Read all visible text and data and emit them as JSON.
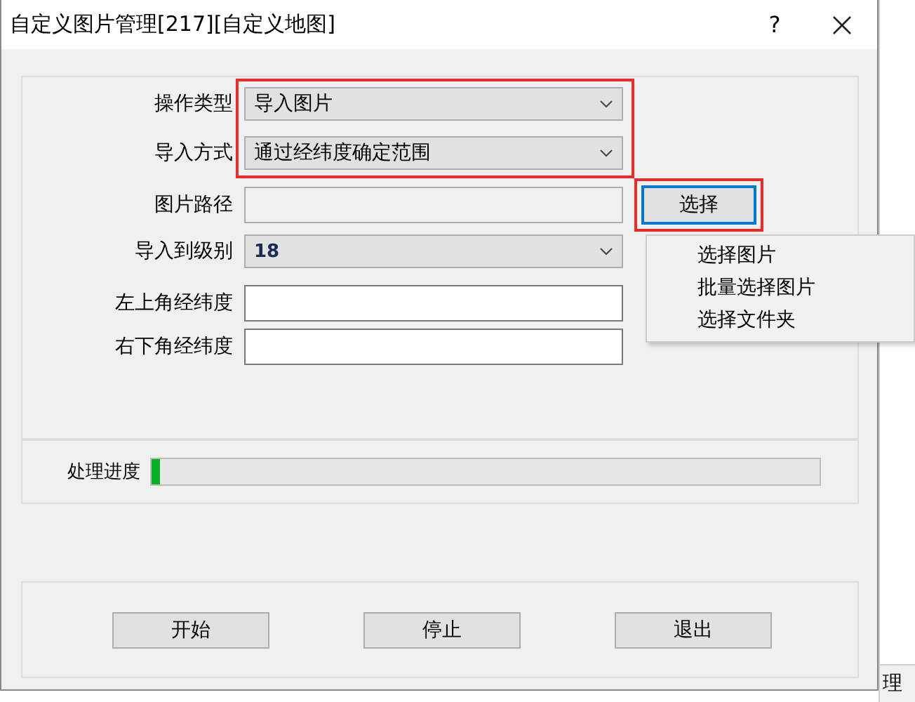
{
  "window": {
    "title": "自定义图片管理[217][自定义地图]",
    "help": "?"
  },
  "form": [
    {
      "kind": "combo",
      "label": "操作类型",
      "value": "导入图片",
      "highlighted": true
    },
    {
      "kind": "combo",
      "label": "导入方式",
      "value": "通过经纬度确定范围",
      "highlighted": true
    },
    {
      "kind": "path",
      "label": "图片路径",
      "button": {
        "label": "选择",
        "highlighted": true
      }
    },
    {
      "kind": "combo",
      "label": "导入到级别",
      "value": "18",
      "highlighted": false
    },
    {
      "kind": "text",
      "label": "左上角经纬度",
      "highlighted": false
    },
    {
      "kind": "text",
      "label": "右下角经纬度",
      "highlighted": false
    }
  ],
  "menu": {
    "items": [
      "选择图片",
      "批量选择图片",
      "选择文件夹"
    ]
  },
  "progress": {
    "label": "处理进度",
    "level": 0.012
  },
  "buttons": [
    "开始",
    "停止",
    "退出"
  ],
  "background": {
    "text": "理"
  }
}
